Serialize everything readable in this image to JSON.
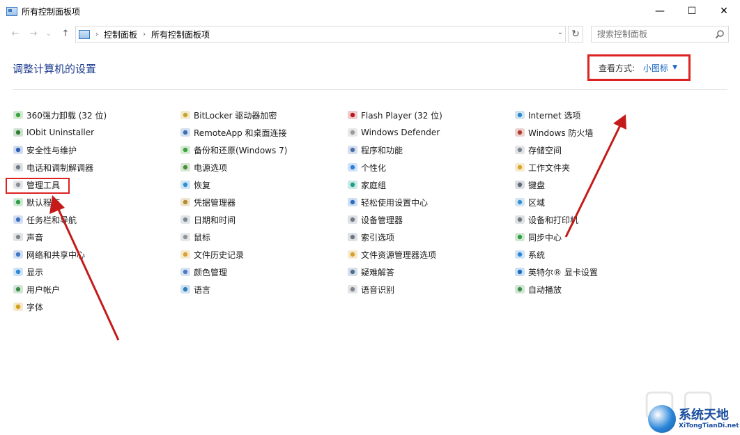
{
  "window": {
    "title": "所有控制面板项",
    "minimize": "—",
    "maximize": "☐",
    "close": "✕"
  },
  "nav": {
    "back": "←",
    "forward": "→",
    "recent": "⌄",
    "up": "↑",
    "breadcrumbs": [
      "控制面板",
      "所有控制面板项"
    ],
    "sep": "›",
    "dropdown": "⌄",
    "refresh": "↻",
    "search_placeholder": "搜索控制面板"
  },
  "header": {
    "title": "调整计算机的设置",
    "view_label": "查看方式:",
    "view_value": "小图标",
    "view_caret": "▼"
  },
  "columns": [
    {
      "items": [
        {
          "label": "360强力卸载 (32 位)",
          "icon": "recycle-icon"
        },
        {
          "label": "IObit Uninstaller",
          "icon": "iobit-icon"
        },
        {
          "label": "安全性与维护",
          "icon": "flag-icon"
        },
        {
          "label": "电话和调制解调器",
          "icon": "phone-modem-icon"
        },
        {
          "label": "管理工具",
          "icon": "admin-tools-icon"
        },
        {
          "label": "默认程序",
          "icon": "default-programs-icon"
        },
        {
          "label": "任务栏和导航",
          "icon": "taskbar-icon"
        },
        {
          "label": "声音",
          "icon": "speaker-icon"
        },
        {
          "label": "网络和共享中心",
          "icon": "network-icon"
        },
        {
          "label": "显示",
          "icon": "display-icon"
        },
        {
          "label": "用户帐户",
          "icon": "users-icon"
        },
        {
          "label": "字体",
          "icon": "font-icon"
        }
      ]
    },
    {
      "items": [
        {
          "label": "BitLocker 驱动器加密",
          "icon": "bitlocker-icon"
        },
        {
          "label": "RemoteApp 和桌面连接",
          "icon": "remoteapp-icon"
        },
        {
          "label": "备份和还原(Windows 7)",
          "icon": "backup-icon"
        },
        {
          "label": "电源选项",
          "icon": "power-icon"
        },
        {
          "label": "恢复",
          "icon": "recovery-icon"
        },
        {
          "label": "凭据管理器",
          "icon": "credential-icon"
        },
        {
          "label": "日期和时间",
          "icon": "clock-icon"
        },
        {
          "label": "鼠标",
          "icon": "mouse-icon"
        },
        {
          "label": "文件历史记录",
          "icon": "file-history-icon"
        },
        {
          "label": "颜色管理",
          "icon": "color-icon"
        },
        {
          "label": "语言",
          "icon": "language-icon"
        }
      ]
    },
    {
      "items": [
        {
          "label": "Flash Player (32 位)",
          "icon": "flash-icon"
        },
        {
          "label": "Windows Defender",
          "icon": "defender-icon"
        },
        {
          "label": "程序和功能",
          "icon": "programs-icon"
        },
        {
          "label": "个性化",
          "icon": "personalize-icon"
        },
        {
          "label": "家庭组",
          "icon": "homegroup-icon"
        },
        {
          "label": "轻松使用设置中心",
          "icon": "ease-access-icon"
        },
        {
          "label": "设备管理器",
          "icon": "device-manager-icon"
        },
        {
          "label": "索引选项",
          "icon": "index-icon"
        },
        {
          "label": "文件资源管理器选项",
          "icon": "folder-options-icon"
        },
        {
          "label": "疑难解答",
          "icon": "troubleshoot-icon"
        },
        {
          "label": "语音识别",
          "icon": "microphone-icon"
        }
      ]
    },
    {
      "items": [
        {
          "label": "Internet 选项",
          "icon": "internet-icon"
        },
        {
          "label": "Windows 防火墙",
          "icon": "firewall-icon"
        },
        {
          "label": "存储空间",
          "icon": "storage-icon"
        },
        {
          "label": "工作文件夹",
          "icon": "work-folders-icon"
        },
        {
          "label": "键盘",
          "icon": "keyboard-icon"
        },
        {
          "label": "区域",
          "icon": "region-icon"
        },
        {
          "label": "设备和打印机",
          "icon": "printer-icon"
        },
        {
          "label": "同步中心",
          "icon": "sync-icon"
        },
        {
          "label": "系统",
          "icon": "system-icon"
        },
        {
          "label": "英特尔® 显卡设置",
          "icon": "intel-graphics-icon"
        },
        {
          "label": "自动播放",
          "icon": "autoplay-icon"
        }
      ]
    }
  ],
  "watermark": {
    "brand_cn": "系统天地",
    "brand_en": "XiTongTianDi.net"
  },
  "icon_colors": {
    "recycle-icon": "#3aa33a",
    "iobit-icon": "#2d7d32",
    "flag-icon": "#2a5fb8",
    "phone-modem-icon": "#6f7b88",
    "admin-tools-icon": "#8a8f96",
    "default-programs-icon": "#2f9e44",
    "taskbar-icon": "#3b6fc2",
    "speaker-icon": "#7f8790",
    "network-icon": "#3f77c7",
    "display-icon": "#2b8ad9",
    "users-icon": "#3b8c4a",
    "font-icon": "#d4a017",
    "bitlocker-icon": "#c9a227",
    "remoteapp-icon": "#3a6fb5",
    "backup-icon": "#3aa33a",
    "power-icon": "#4a8f3a",
    "recovery-icon": "#2e8fd1",
    "credential-icon": "#b68a2e",
    "clock-icon": "#7a8794",
    "mouse-icon": "#8d949c",
    "file-history-icon": "#d6a22c",
    "color-icon": "#4b7cc4",
    "language-icon": "#2c7fbf",
    "flash-icon": "#b7181d",
    "defender-icon": "#9a9a9a",
    "programs-icon": "#4a6fa8",
    "personalize-icon": "#2f7ed8",
    "homegroup-icon": "#1a9f8a",
    "ease-access-icon": "#2b6cc0",
    "device-manager-icon": "#707a86",
    "index-icon": "#6b7784",
    "folder-options-icon": "#d6a22c",
    "troubleshoot-icon": "#4d6e96",
    "microphone-icon": "#7d848c",
    "internet-icon": "#2f86c9",
    "firewall-icon": "#b23b2e",
    "storage-icon": "#7b8590",
    "work-folders-icon": "#d8a52a",
    "keyboard-icon": "#5f6a75",
    "region-icon": "#3a8fd1",
    "printer-icon": "#6d7782",
    "sync-icon": "#2e9e3e",
    "system-icon": "#2f86d9",
    "intel-graphics-icon": "#1a6fc2",
    "autoplay-icon": "#3a8f4a"
  }
}
